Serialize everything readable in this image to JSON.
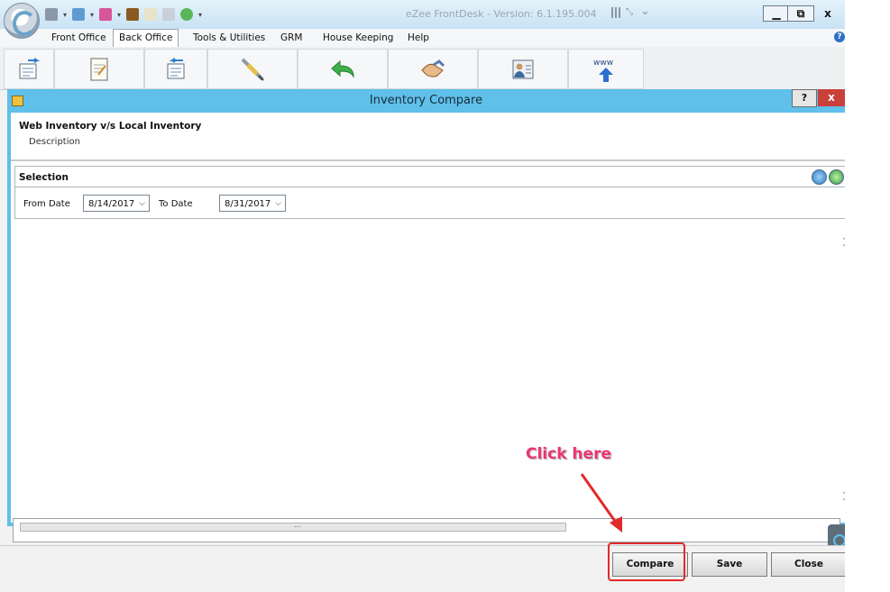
{
  "window": {
    "title": "eZee FrontDesk - Version: 6.1.195.004",
    "controls": {
      "minimize": "▁",
      "restore": "⧉",
      "close": "x"
    }
  },
  "menu": {
    "items": [
      {
        "label": "Front Office"
      },
      {
        "label": "Back Office"
      },
      {
        "label": "Tools & Utilities"
      },
      {
        "label": "GRM"
      },
      {
        "label": "House Keeping"
      },
      {
        "label": "Help"
      }
    ],
    "active": "Back Office"
  },
  "toolbar": {
    "icons": [
      "import-icon",
      "notepad-icon",
      "export-icon",
      "syringe-icon",
      "undo-arrow-icon",
      "handshake-icon",
      "guest-card-icon",
      "www-upload-icon"
    ],
    "www_text": "www"
  },
  "dialog": {
    "title": "Inventory Compare",
    "help_label": "?",
    "close_label": "x",
    "header_title": "Web Inventory v/s Local Inventory",
    "header_description": "Description",
    "selection": {
      "title": "Selection",
      "from_label": "From Date",
      "from_value": "8/14/2017",
      "to_label": "To Date",
      "to_value": "8/31/2017"
    },
    "scroll_grip": "..."
  },
  "footer": {
    "compare_label": "Compare",
    "save_label": "Save",
    "close_label": "Close"
  },
  "annotation": {
    "callout_text": "Click here"
  },
  "colors": {
    "dialog_frame": "#5fc0ea",
    "callout": "#ea3470",
    "highlight": "#e22a2a"
  }
}
